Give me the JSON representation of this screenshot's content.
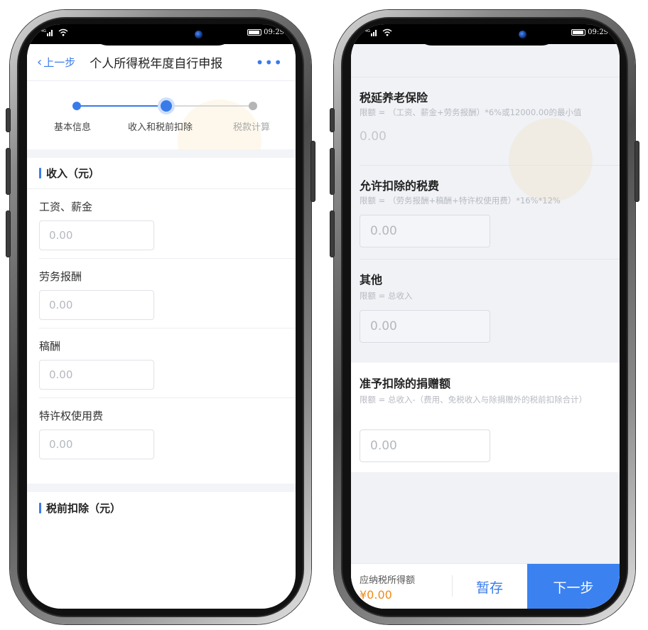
{
  "status_bar": {
    "network": "4G",
    "time": "09:29"
  },
  "left_phone": {
    "nav": {
      "back_label": "上一步",
      "title": "个人所得税年度自行申报",
      "more_label": "•••"
    },
    "steps": [
      {
        "label": "基本信息",
        "state": "done"
      },
      {
        "label": "收入和税前扣除",
        "state": "current"
      },
      {
        "label": "税款计算",
        "state": "pending"
      }
    ],
    "income_section": {
      "title": "收入（元）",
      "fields": [
        {
          "label": "工资、薪金",
          "placeholder": "0.00"
        },
        {
          "label": "劳务报酬",
          "placeholder": "0.00"
        },
        {
          "label": "稿酬",
          "placeholder": "0.00"
        },
        {
          "label": "特许权使用费",
          "placeholder": "0.00"
        }
      ]
    },
    "deduction_section": {
      "title": "税前扣除（元）"
    }
  },
  "right_phone": {
    "items": [
      {
        "title": "税延养老保险",
        "limit": "限额 = （工资、薪金+劳务报酬）*6%或12000.00的最小值",
        "value": "0.00"
      },
      {
        "title": "允许扣除的税费",
        "limit": "限额 = （劳务报酬+稿酬+特许权使用费）*16%*12%",
        "value": "0.00"
      },
      {
        "title": "其他",
        "limit": "限额 = 总收入",
        "value": "0.00"
      },
      {
        "title": "准予扣除的捐赠额",
        "limit": "限额 = 总收入-（费用、免税收入与除捐赠外的税前扣除合计）",
        "value": "0.00"
      }
    ],
    "bottom_bar": {
      "taxable_label": "应纳税所得额",
      "taxable_amount": "¥0.00",
      "save_label": "暂存",
      "next_label": "下一步"
    }
  },
  "colors": {
    "accent": "#3a7bea",
    "next_button": "#3b82f0",
    "amount": "#f08a1c",
    "muted_step": "#b5b5b5"
  }
}
